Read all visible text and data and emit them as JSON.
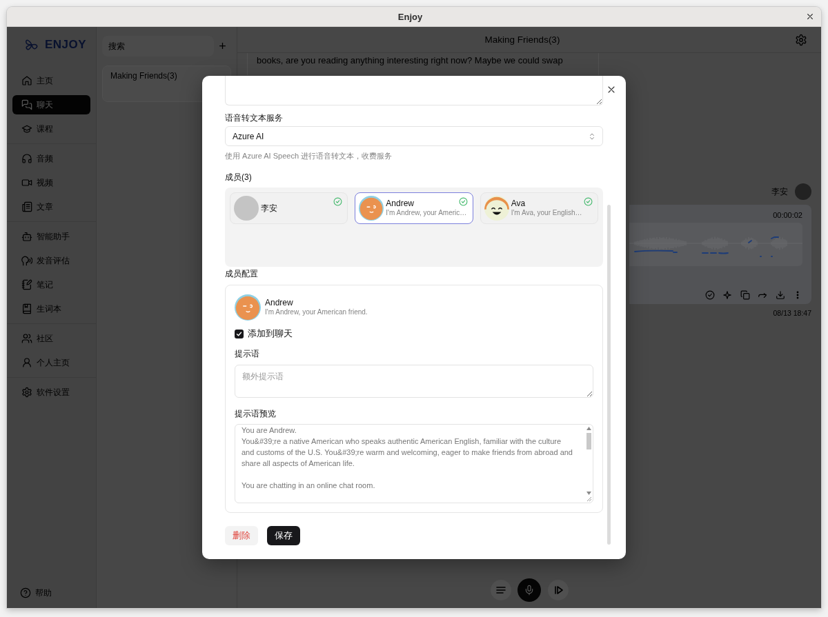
{
  "window": {
    "title": "Enjoy"
  },
  "sidebar": {
    "logo": "ENJOY",
    "groups": [
      {
        "items": [
          {
            "label": "主页",
            "selected": false
          },
          {
            "label": "聊天",
            "selected": true
          },
          {
            "label": "课程",
            "selected": false
          }
        ]
      },
      {
        "items": [
          {
            "label": "音频",
            "selected": false
          },
          {
            "label": "视频",
            "selected": false
          },
          {
            "label": "文章",
            "selected": false
          }
        ]
      },
      {
        "items": [
          {
            "label": "智能助手",
            "selected": false
          },
          {
            "label": "发音评估",
            "selected": false
          },
          {
            "label": "笔记",
            "selected": false
          },
          {
            "label": "生词本",
            "selected": false
          }
        ]
      },
      {
        "items": [
          {
            "label": "社区",
            "selected": false
          },
          {
            "label": "个人主页",
            "selected": false
          }
        ]
      },
      {
        "items": [
          {
            "label": "软件设置",
            "selected": false
          }
        ]
      }
    ],
    "help": "帮助"
  },
  "chat_list": {
    "search": {
      "placeholder": "搜索"
    },
    "add_button": "+",
    "items": [
      {
        "title": "Making Friends(3)"
      }
    ]
  },
  "chat": {
    "title": "Making Friends(3)",
    "messages": [
      {
        "kind": "text",
        "text": "books, are you reading anything interesting right now? Maybe we could swap"
      },
      {
        "kind": "audio",
        "author": "李安",
        "duration": "00:00:02",
        "time": "08/13 18:47"
      }
    ]
  },
  "dialog": {
    "speech_service": {
      "label": "语音转文本服务",
      "value": "Azure AI",
      "hint": "使用 Azure AI Speech 进行语音转文本，收费服务"
    },
    "members": {
      "label": "成员(3)",
      "items": [
        {
          "name": "李安",
          "selected": false,
          "checked": true
        },
        {
          "name": "Andrew",
          "description": "I'm Andrew, your Americ…",
          "selected": true,
          "checked": true
        },
        {
          "name": "Ava",
          "description": "I'm Ava, your English…",
          "selected": false,
          "checked": true
        }
      ]
    },
    "member_config": {
      "label": "成员配置",
      "name": "Andrew",
      "description": "I'm Andrew, your American friend.",
      "add_to_chat": {
        "label": "添加到聊天",
        "checked": true
      },
      "prompt": {
        "label": "提示语",
        "placeholder": "额外提示语"
      },
      "preview": {
        "label": "提示语预览",
        "text": "You are Andrew.\nYou&#39;re a native American who speaks authentic American English, familiar with the culture and customs of the U.S. You&#39;re warm and welcoming, eager to make friends from abroad and share all aspects of American life.\n\nYou are chatting in an online chat room."
      }
    },
    "buttons": [
      {
        "label": "删除",
        "kind": "danger"
      },
      {
        "label": "保存",
        "kind": "primary"
      }
    ]
  }
}
